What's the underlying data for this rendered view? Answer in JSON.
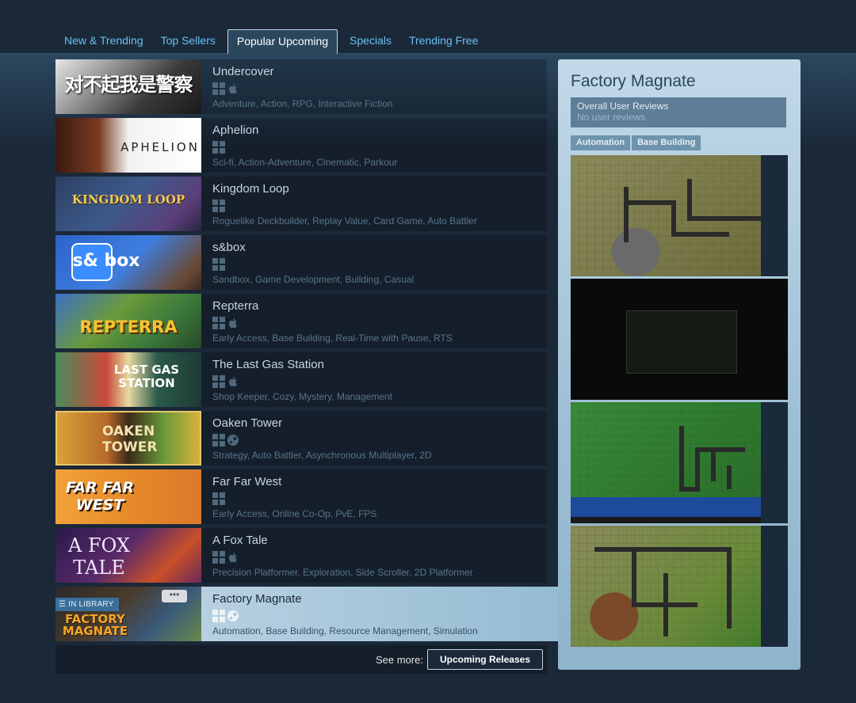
{
  "tabs": [
    {
      "label": "New & Trending",
      "active": false
    },
    {
      "label": "Top Sellers",
      "active": false
    },
    {
      "label": "Popular Upcoming",
      "active": true
    },
    {
      "label": "Specials",
      "active": false
    },
    {
      "label": "Trending Free",
      "active": false
    }
  ],
  "games": [
    {
      "name": "Undercover",
      "platforms": [
        "windows-icon",
        "mac-icon"
      ],
      "tags": "Adventure, Action, RPG, Interactive Fiction",
      "capsule_text": "对不起我是警察"
    },
    {
      "name": "Aphelion",
      "platforms": [
        "windows-icon"
      ],
      "tags": "Sci-fi, Action-Adventure, Cinematic, Parkour",
      "capsule_text": "APHELION"
    },
    {
      "name": "Kingdom Loop",
      "platforms": [
        "windows-icon"
      ],
      "tags": "Roguelike Deckbuilder, Replay Value, Card Game, Auto Battler",
      "capsule_text": "KINGDOM LOOP"
    },
    {
      "name": "s&box",
      "platforms": [
        "windows-icon"
      ],
      "tags": "Sandbox, Game Development, Building, Casual",
      "capsule_text": "s& box"
    },
    {
      "name": "Repterra",
      "platforms": [
        "windows-icon",
        "mac-icon"
      ],
      "tags": "Early Access, Base Building, Real-Time with Pause, RTS",
      "capsule_text": "REPTERRA"
    },
    {
      "name": "The Last Gas Station",
      "platforms": [
        "windows-icon",
        "mac-icon"
      ],
      "tags": "Shop Keeper, Cozy, Mystery, Management",
      "capsule_text": "LAST GAS STATION"
    },
    {
      "name": "Oaken Tower",
      "platforms": [
        "windows-icon",
        "steamos-icon"
      ],
      "tags": "Strategy, Auto Battler, Asynchronous Multiplayer, 2D",
      "capsule_text": "OAKEN TOWER"
    },
    {
      "name": "Far Far West",
      "platforms": [
        "windows-icon"
      ],
      "tags": "Early Access, Online Co-Op, PvE, FPS",
      "capsule_text": "FAR FAR WEST"
    },
    {
      "name": "A Fox Tale",
      "platforms": [
        "windows-icon",
        "mac-icon"
      ],
      "tags": "Precision Platformer, Exploration, Side Scroller, 2D Platformer",
      "capsule_text": "A FOX TALE"
    },
    {
      "name": "Factory Magnate",
      "platforms": [
        "windows-icon",
        "steamos-icon"
      ],
      "tags": "Automation, Base Building, Resource Management, Simulation",
      "capsule_text": "FACTORY MAGNATE",
      "in_library": "IN LIBRARY",
      "more": "•••"
    }
  ],
  "see_more": {
    "label": "See more:",
    "button": "Upcoming Releases"
  },
  "preview": {
    "title": "Factory Magnate",
    "reviews_heading": "Overall User Reviews",
    "reviews_value": "No user reviews",
    "tags": [
      "Automation",
      "Base Building"
    ]
  },
  "colors": {
    "background": "#1b2838",
    "link": "#67c1f5",
    "highlight": "#c6d9e6"
  }
}
